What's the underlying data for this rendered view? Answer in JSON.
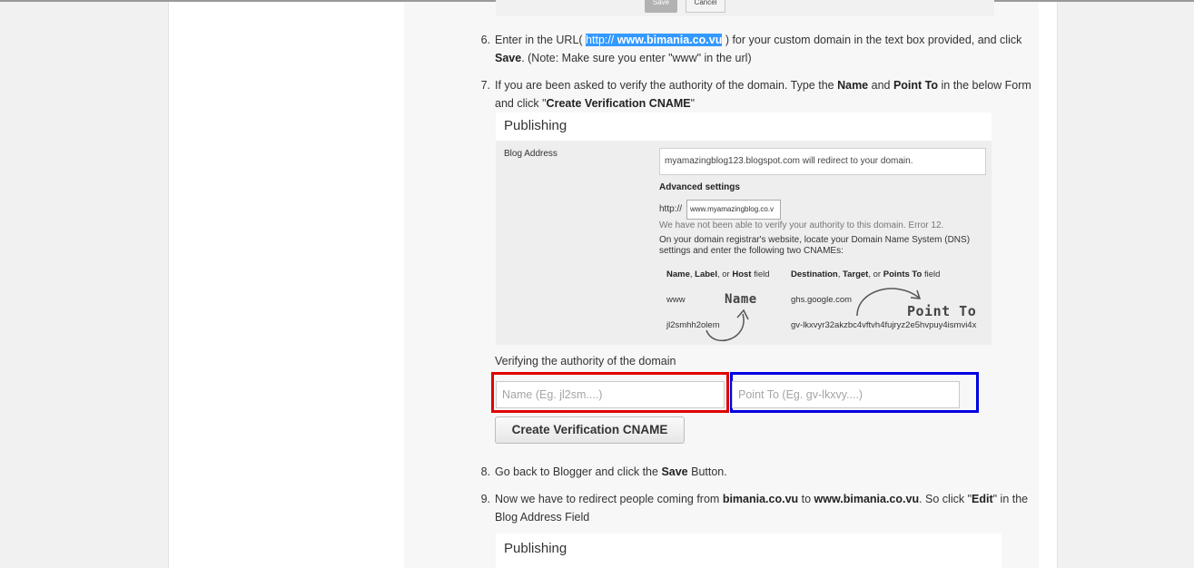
{
  "top_shot": {
    "save_label": "Save",
    "cancel_label": "Cancel"
  },
  "steps": [
    {
      "num": "6.",
      "parts": [
        {
          "t": "Enter in the URL( "
        },
        {
          "t": "http:// ",
          "hl": true
        },
        {
          "t": "www.bimania.co.vu",
          "hl": true,
          "b": true
        },
        {
          "t": " ) for your custom domain in the text box provided, and click "
        },
        {
          "t": "Save",
          "b": true
        },
        {
          "t": ". (Note: Make sure you enter \"www\" in the url)"
        }
      ]
    },
    {
      "num": "7.",
      "parts": [
        {
          "t": "If you are been asked to verify the authority of the domain. Type the "
        },
        {
          "t": "Name",
          "b": true
        },
        {
          "t": " and "
        },
        {
          "t": "Point To",
          "b": true
        },
        {
          "t": " in the below Form and click \""
        },
        {
          "t": "Create Verification CNAME",
          "b": true
        },
        {
          "t": "\""
        }
      ]
    },
    {
      "num": "8.",
      "parts": [
        {
          "t": "Go back to Blogger and click the "
        },
        {
          "t": "Save",
          "b": true
        },
        {
          "t": " Button."
        }
      ]
    },
    {
      "num": "9.",
      "parts": [
        {
          "t": "Now we have to redirect people coming from "
        },
        {
          "t": "bimania.co.vu",
          "b": true
        },
        {
          "t": " to "
        },
        {
          "t": "www.bimania.co.vu",
          "b": true
        },
        {
          "t": ". So click \""
        },
        {
          "t": "Edit",
          "b": true
        },
        {
          "t": "\" in the Blog Address Field"
        }
      ]
    }
  ],
  "screenshot1": {
    "header": "Publishing",
    "blog_address_label": "Blog Address",
    "blog_address_value": "myamazingblog123.blogspot.com    will redirect to your domain.",
    "advanced_settings": "Advanced settings",
    "http_prefix": "http://",
    "url_value": "www.myamazingblog.co.v",
    "error_text": "We have not been able to verify your authority to this domain. Error 12.",
    "info_text": "On your domain registrar's website, locate your Domain Name System (DNS) settings and enter the following two CNAMEs:",
    "col1_header_html": "<b>Name</b>, <b>Label</b>, or <b>Host</b> field",
    "col2_header_html": "<b>Destination</b>, <b>Target</b>, or <b>Points To</b> field",
    "row1_name": "www",
    "row1_dest": "ghs.google.com",
    "row2_name": "jl2smhh2olem",
    "row2_dest": "gv-lkxvyr32akzbc4vftvh4fujryz2e5hvpuy4ismvi4x",
    "annot_name": "Name",
    "annot_point": "Point To"
  },
  "verify": {
    "label": "Verifying the authority of the domain",
    "name_placeholder": "Name (Eg. jl2sm....)",
    "point_placeholder": "Point To (Eg. gv-lkxvy....)",
    "button_label": "Create Verification CNAME"
  },
  "screenshot2": {
    "header": "Publishing"
  },
  "colors": {
    "highlight": "#3399ff",
    "red_box": "#e00000",
    "blue_box": "#0000e0"
  }
}
